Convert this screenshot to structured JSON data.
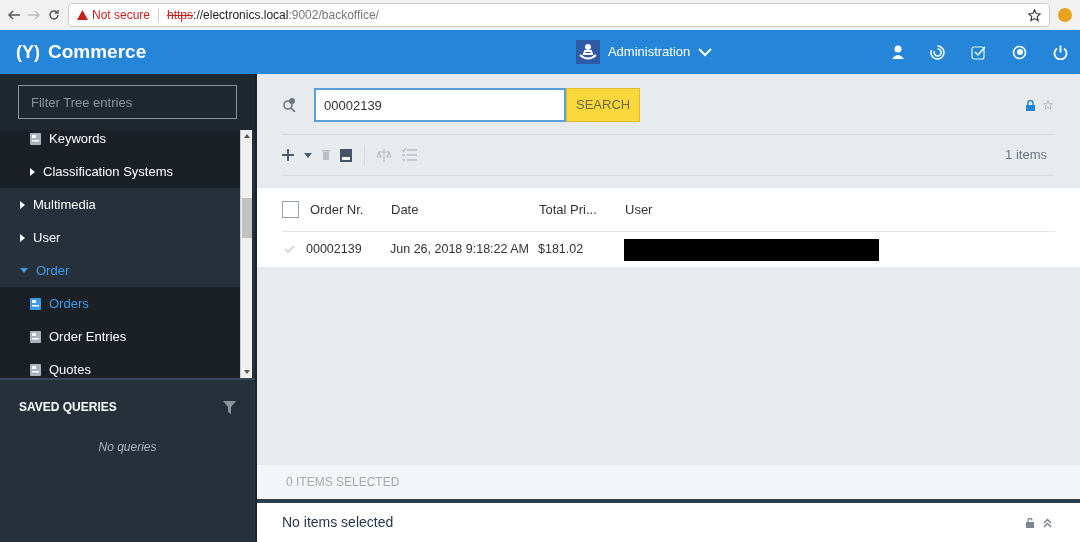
{
  "browser": {
    "security": "Not secure",
    "url_scheme": "https",
    "url_host": "://electronics.local",
    "url_rest": ":9002/backoffice/"
  },
  "header": {
    "logo_mark": "(Y)",
    "title": "Commerce",
    "perspective": "Administration"
  },
  "sidebar": {
    "filter_placeholder": "Filter Tree entries",
    "tree": [
      {
        "children": [
          {
            "label": "Keywords",
            "kind": "type",
            "selected": false
          },
          {
            "label": "Classification Systems",
            "kind": "folder",
            "expanded": false
          }
        ]
      },
      {
        "label": "Multimedia",
        "kind": "folder",
        "expanded": false
      },
      {
        "label": "User",
        "kind": "folder",
        "expanded": false
      },
      {
        "label": "Order",
        "kind": "folder",
        "expanded": true,
        "children": [
          {
            "label": "Orders",
            "kind": "type",
            "selected": true
          },
          {
            "label": "Order Entries",
            "kind": "type",
            "selected": false
          },
          {
            "label": "Quotes",
            "kind": "type",
            "selected": false
          }
        ]
      }
    ],
    "saved_queries": {
      "title": "SAVED QUERIES",
      "empty": "No queries"
    }
  },
  "search": {
    "value": "00002139",
    "button": "SEARCH"
  },
  "toolbar": {
    "count": "1 items"
  },
  "table": {
    "select_all_checked": false,
    "columns": [
      "Order Nr.",
      "Date",
      "Total Pri...",
      "User"
    ],
    "rows": [
      {
        "checked": false,
        "cells": [
          "00002139",
          "Jun 26, 2018 9:18:22 AM",
          "$181.02"
        ],
        "user_redacted": true
      }
    ]
  },
  "selection_bar": "0 ITEMS SELECTED",
  "detail": {
    "title": "No items selected"
  }
}
